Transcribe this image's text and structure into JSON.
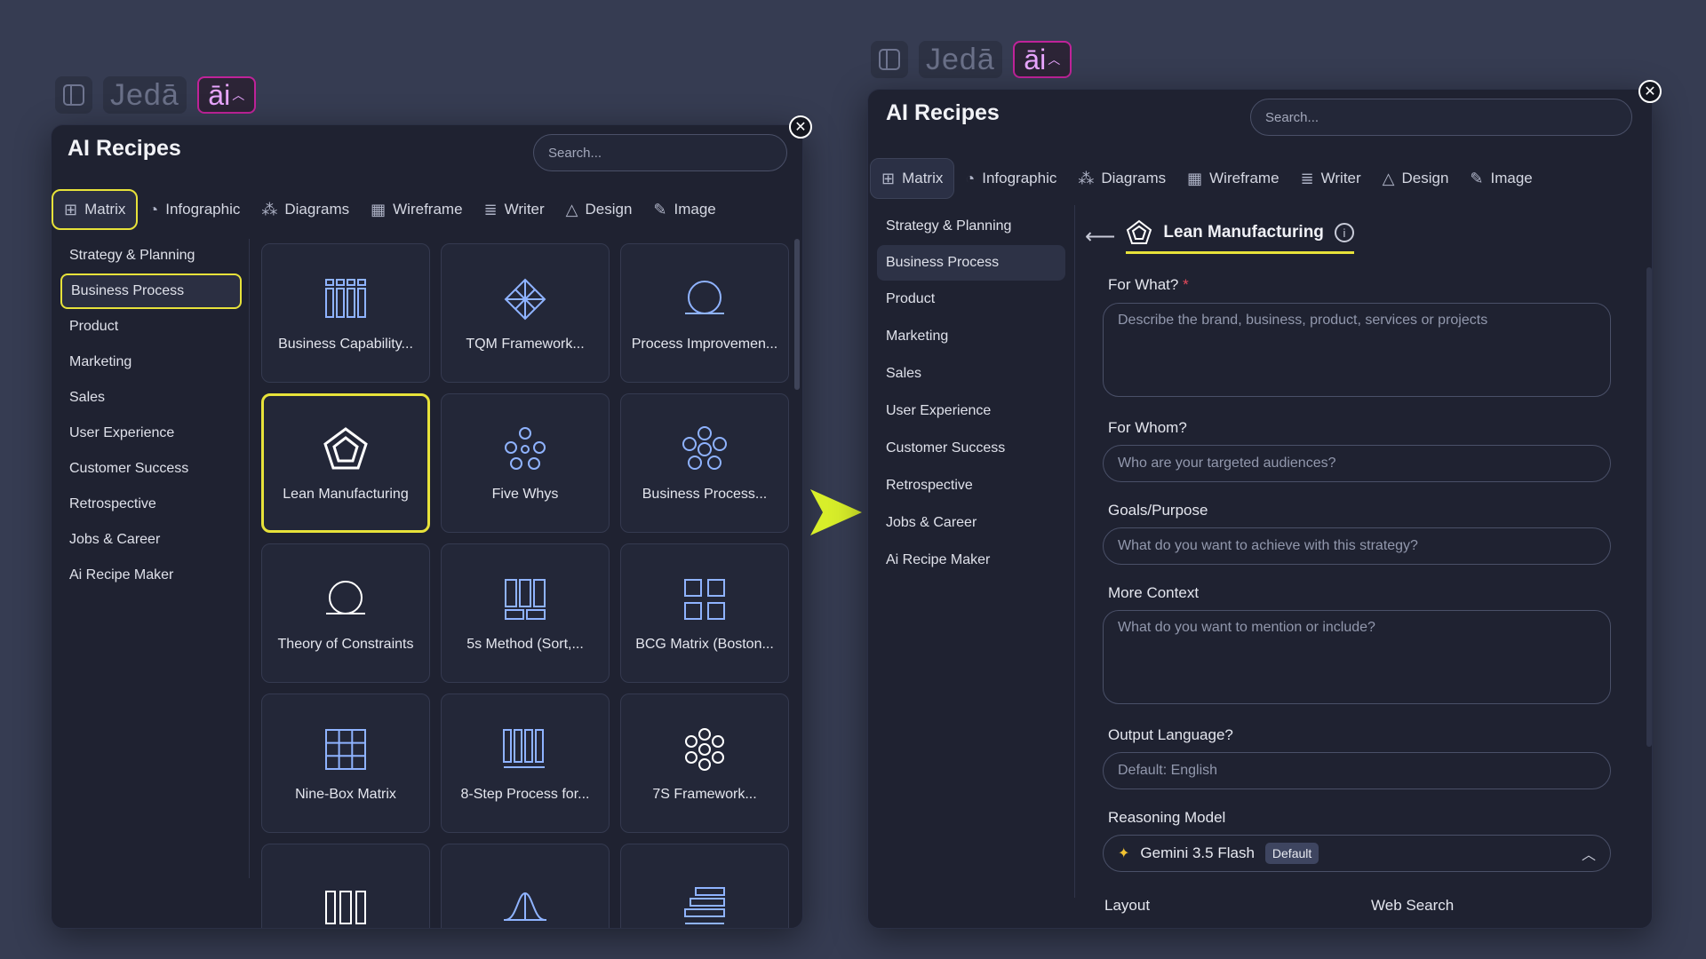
{
  "left_toolbar": {
    "jeda": "Jedā",
    "ai": "āi"
  },
  "right_toolbar": {
    "jeda": "Jedā",
    "ai": "āi"
  },
  "left_panel": {
    "title": "AI Recipes",
    "search_placeholder": "Search...",
    "tabs": [
      {
        "label": "Matrix",
        "icon": "grid-icon"
      },
      {
        "label": "Infographic",
        "icon": "pie-icon"
      },
      {
        "label": "Diagrams",
        "icon": "shapes-icon"
      },
      {
        "label": "Wireframe",
        "icon": "wireframe-icon"
      },
      {
        "label": "Writer",
        "icon": "writer-icon"
      },
      {
        "label": "Design",
        "icon": "design-icon"
      },
      {
        "label": "Image",
        "icon": "image-icon"
      }
    ],
    "categories": [
      "Strategy & Planning",
      "Business Process",
      "Product",
      "Marketing",
      "Sales",
      "User Experience",
      "Customer Success",
      "Retrospective",
      "Jobs & Career",
      "Ai Recipe Maker"
    ],
    "selected_category": "Business Process",
    "cards": [
      {
        "label": "Business Capability...",
        "icon": "capability-icon"
      },
      {
        "label": "TQM Framework...",
        "icon": "diamond-grid-icon"
      },
      {
        "label": "Process Improvemen...",
        "icon": "cycle-icon"
      },
      {
        "label": "Lean Manufacturing",
        "icon": "pentagon-icon"
      },
      {
        "label": "Five Whys",
        "icon": "circles-icon"
      },
      {
        "label": "Business Process...",
        "icon": "flower-icon"
      },
      {
        "label": "Theory of Constraints",
        "icon": "cycle-icon"
      },
      {
        "label": "5s Method (Sort,...",
        "icon": "columns-icon"
      },
      {
        "label": "BCG Matrix (Boston...",
        "icon": "quad-icon"
      },
      {
        "label": "Nine-Box Matrix",
        "icon": "ninebox-icon"
      },
      {
        "label": "8-Step Process for...",
        "icon": "bars-icon"
      },
      {
        "label": "7S Framework...",
        "icon": "flower-icon"
      },
      {
        "label": "",
        "icon": "columns-icon"
      },
      {
        "label": "",
        "icon": "bell-curve-icon"
      },
      {
        "label": "",
        "icon": "stack-icon"
      }
    ]
  },
  "right_panel": {
    "title": "AI Recipes",
    "search_placeholder": "Search...",
    "tabs": [
      {
        "label": "Matrix",
        "icon": "grid-icon"
      },
      {
        "label": "Infographic",
        "icon": "pie-icon"
      },
      {
        "label": "Diagrams",
        "icon": "shapes-icon"
      },
      {
        "label": "Wireframe",
        "icon": "wireframe-icon"
      },
      {
        "label": "Writer",
        "icon": "writer-icon"
      },
      {
        "label": "Design",
        "icon": "design-icon"
      },
      {
        "label": "Image",
        "icon": "image-icon"
      }
    ],
    "categories": [
      "Strategy & Planning",
      "Business Process",
      "Product",
      "Marketing",
      "Sales",
      "User Experience",
      "Customer Success",
      "Retrospective",
      "Jobs & Career",
      "Ai Recipe Maker"
    ],
    "recipe_title": "Lean Manufacturing",
    "form": {
      "for_what": {
        "label": "For What?",
        "required": "*",
        "placeholder": "Describe the brand, business, product, services or projects"
      },
      "for_whom": {
        "label": "For Whom?",
        "placeholder": "Who are your targeted audiences?"
      },
      "goals": {
        "label": "Goals/Purpose",
        "placeholder": "What do you want to achieve with this strategy?"
      },
      "context": {
        "label": "More Context",
        "placeholder": "What do you want to mention or include?"
      },
      "language": {
        "label": "Output Language?",
        "placeholder": "Default: English"
      },
      "model": {
        "label": "Reasoning Model",
        "name": "Gemini 3.5 Flash",
        "badge": "Default"
      },
      "layout_label": "Layout",
      "web_search_label": "Web Search"
    }
  },
  "colors": {
    "highlight": "#e7e23a",
    "accent_pink": "#c0239a",
    "panel_bg": "#1f2231",
    "page_bg": "#363c52"
  }
}
